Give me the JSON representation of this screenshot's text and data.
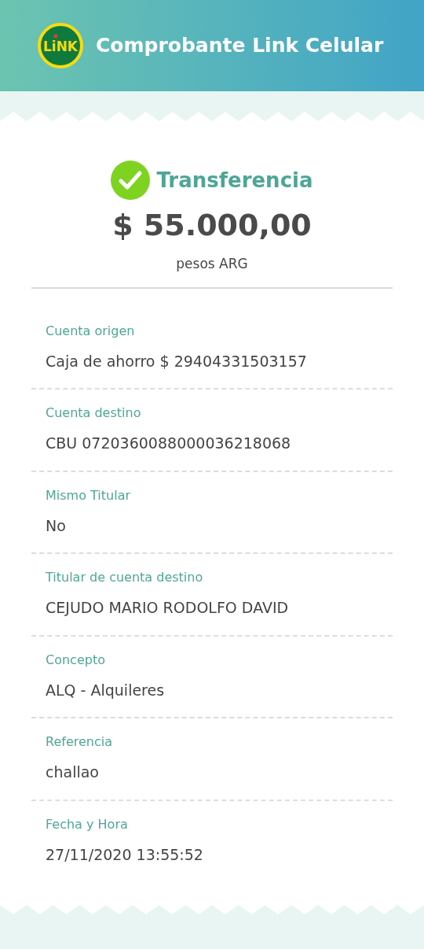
{
  "header": {
    "logo_text": "LiNK",
    "title": "Comprobante Link Celular"
  },
  "summary": {
    "type": "Transferencia",
    "success": true,
    "amount": "$ 55.000,00",
    "currency": "pesos ARG"
  },
  "fields": [
    {
      "label": "Cuenta origen",
      "value": "Caja de ahorro $ 29404331503157"
    },
    {
      "label": "Cuenta destino",
      "value": "CBU 0720360088000036218068"
    },
    {
      "label": "Mismo Titular",
      "value": "No"
    },
    {
      "label": "Titular de cuenta destino",
      "value": "CEJUDO MARIO RODOLFO DAVID"
    },
    {
      "label": "Concepto",
      "value": "ALQ - Alquileres"
    },
    {
      "label": "Referencia",
      "value": "challao"
    },
    {
      "label": "Fecha y Hora",
      "value": "27/11/2020 13:55:52"
    }
  ]
}
